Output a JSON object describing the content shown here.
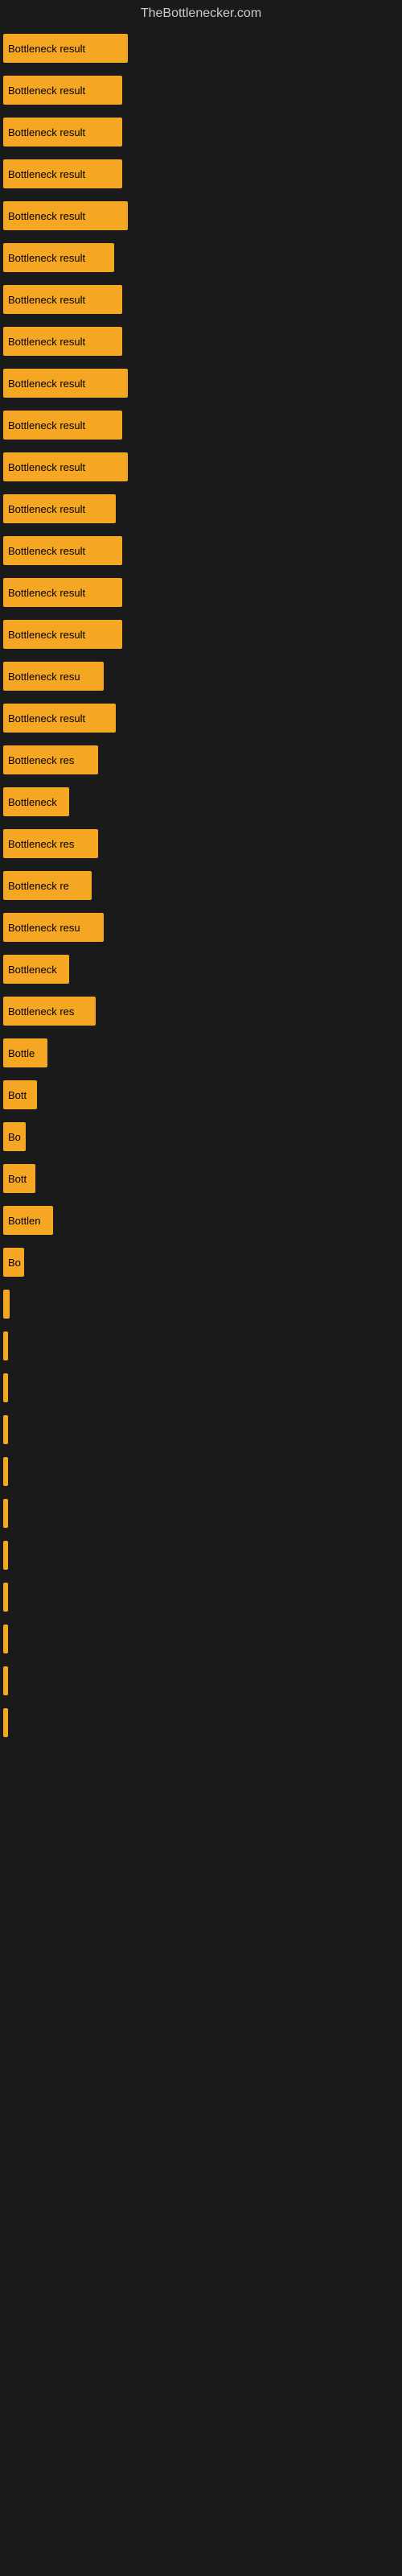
{
  "site": {
    "title": "TheBottlenecker.com"
  },
  "bars": [
    {
      "label": "Bottleneck result",
      "width": 155
    },
    {
      "label": "Bottleneck result",
      "width": 148
    },
    {
      "label": "Bottleneck result",
      "width": 148
    },
    {
      "label": "Bottleneck result",
      "width": 148
    },
    {
      "label": "Bottleneck result",
      "width": 155
    },
    {
      "label": "Bottleneck result",
      "width": 138
    },
    {
      "label": "Bottleneck result",
      "width": 148
    },
    {
      "label": "Bottleneck result",
      "width": 148
    },
    {
      "label": "Bottleneck result",
      "width": 155
    },
    {
      "label": "Bottleneck result",
      "width": 148
    },
    {
      "label": "Bottleneck result",
      "width": 155
    },
    {
      "label": "Bottleneck result",
      "width": 140
    },
    {
      "label": "Bottleneck result",
      "width": 148
    },
    {
      "label": "Bottleneck result",
      "width": 148
    },
    {
      "label": "Bottleneck result",
      "width": 148
    },
    {
      "label": "Bottleneck resu",
      "width": 125
    },
    {
      "label": "Bottleneck result",
      "width": 140
    },
    {
      "label": "Bottleneck res",
      "width": 118
    },
    {
      "label": "Bottleneck",
      "width": 82
    },
    {
      "label": "Bottleneck res",
      "width": 118
    },
    {
      "label": "Bottleneck re",
      "width": 110
    },
    {
      "label": "Bottleneck resu",
      "width": 125
    },
    {
      "label": "Bottleneck",
      "width": 82
    },
    {
      "label": "Bottleneck res",
      "width": 115
    },
    {
      "label": "Bottle",
      "width": 55
    },
    {
      "label": "Bott",
      "width": 42
    },
    {
      "label": "Bo",
      "width": 28
    },
    {
      "label": "Bott",
      "width": 40
    },
    {
      "label": "Bottlen",
      "width": 62
    },
    {
      "label": "Bo",
      "width": 26
    },
    {
      "label": "",
      "width": 8
    },
    {
      "label": "",
      "width": 4
    },
    {
      "label": "",
      "width": 4
    },
    {
      "label": "",
      "width": 4
    },
    {
      "label": "",
      "width": 4
    },
    {
      "label": "",
      "width": 4
    },
    {
      "label": "",
      "width": 4
    },
    {
      "label": "",
      "width": 4
    },
    {
      "label": "",
      "width": 4
    },
    {
      "label": "",
      "width": 4
    },
    {
      "label": "",
      "width": 4
    }
  ]
}
